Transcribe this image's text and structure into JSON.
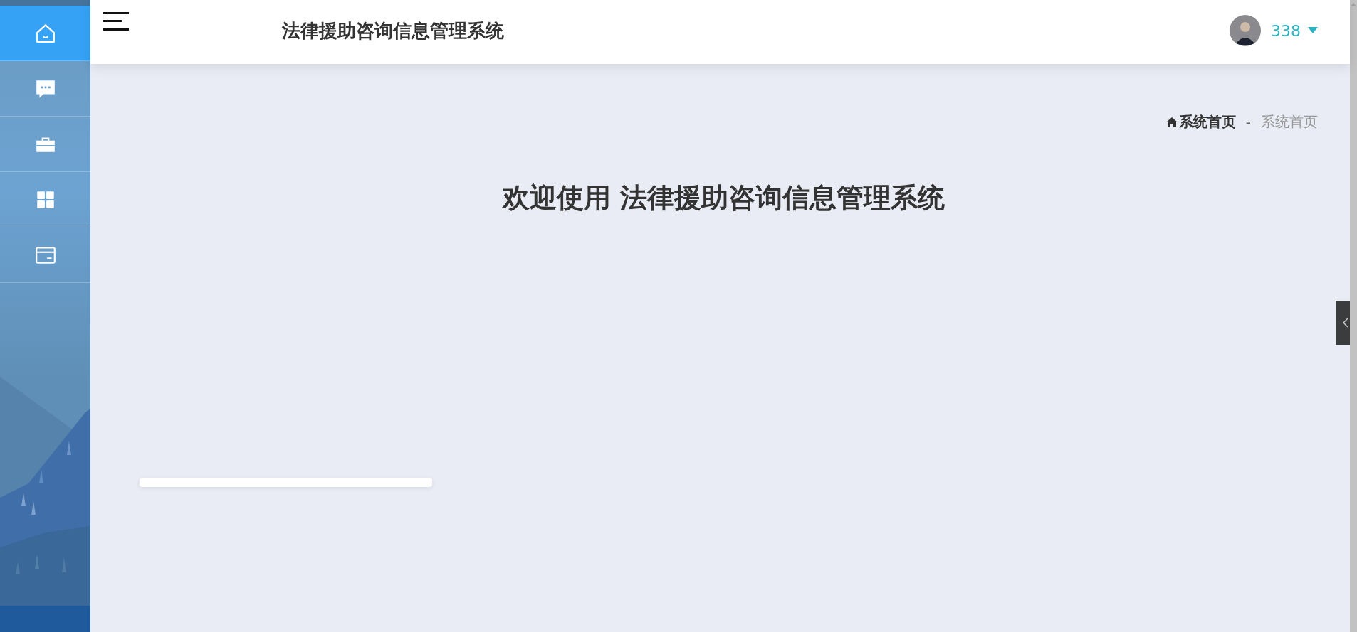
{
  "sidebar": {
    "items": [
      {
        "selected": true
      },
      {
        "selected": false
      },
      {
        "selected": false
      },
      {
        "selected": false
      },
      {
        "selected": false
      }
    ]
  },
  "header": {
    "title": "法律援助咨询信息管理系统",
    "user": {
      "name": "338"
    }
  },
  "breadcrumb": {
    "items": [
      {
        "label": "系统首页"
      },
      {
        "label": "系统首页"
      }
    ],
    "separator": "-"
  },
  "welcome": {
    "title": "欢迎使用 法律援助咨询信息管理系统"
  }
}
